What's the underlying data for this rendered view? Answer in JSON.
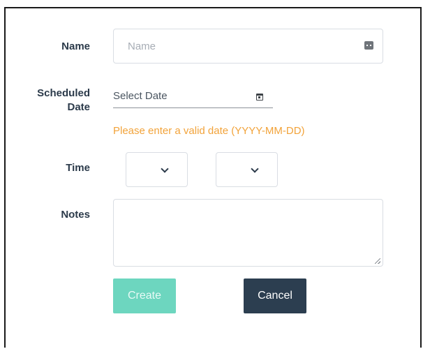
{
  "form": {
    "name": {
      "label": "Name",
      "placeholder": "Name",
      "value": ""
    },
    "scheduled_date": {
      "label_line1": "Scheduled",
      "label_line2": "Date",
      "placeholder": "Select Date",
      "error": "Please enter a valid date (YYYY-MM-DD)"
    },
    "time": {
      "label": "Time",
      "hours_selected": "",
      "minutes_selected": ""
    },
    "notes": {
      "label": "Notes",
      "value": ""
    },
    "buttons": {
      "create_label": "Create",
      "cancel_label": "Cancel"
    }
  },
  "colors": {
    "label_text": "#2b3a4a",
    "error": "#f2a33a",
    "create_button": "#6dd6bf",
    "cancel_button": "#2c3e50",
    "input_border": "#d9dde3"
  },
  "icons": {
    "name_field": "password-key-icon",
    "date_field": "calendar-icon",
    "select": "chevron-down-icon",
    "textarea": "resize-handle-icon"
  }
}
